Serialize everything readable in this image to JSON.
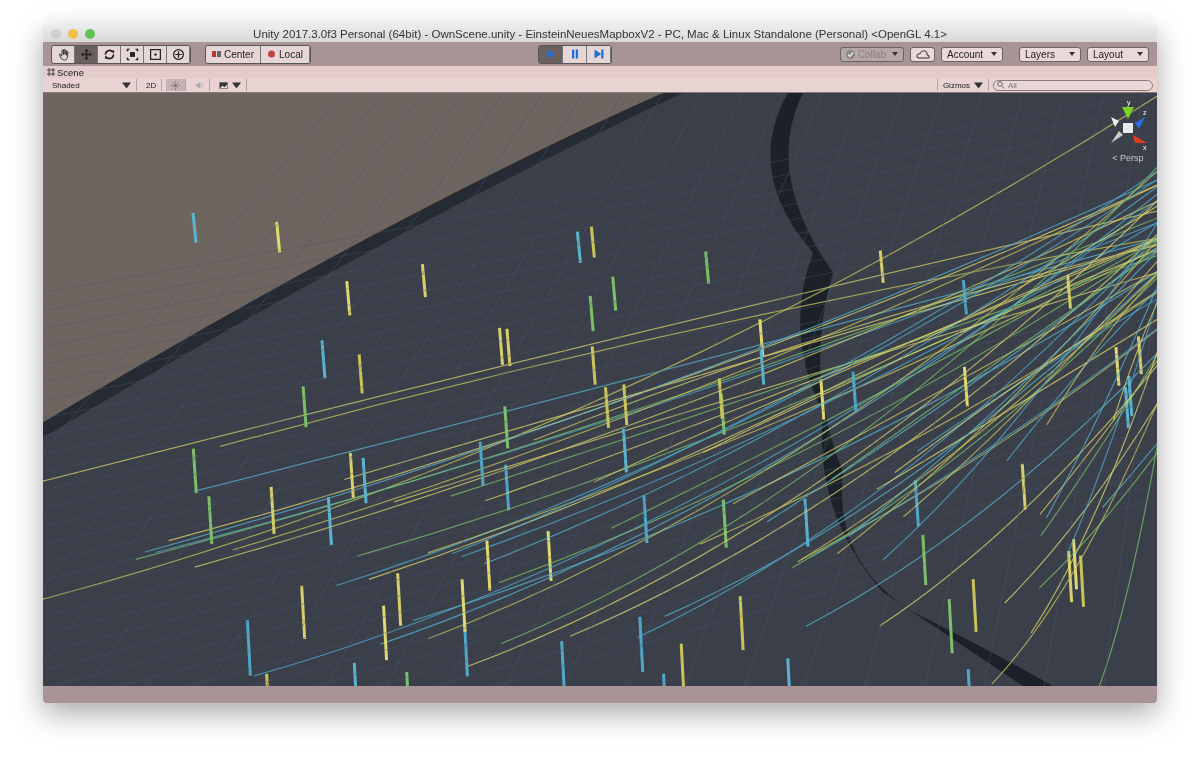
{
  "window": {
    "title": "Unity 2017.3.0f3 Personal (64bit) - OwnScene.unity - EinsteinNeuesMapboxV2 - PC, Mac & Linux Standalone (Personal) <OpenGL 4.1>"
  },
  "tools": [
    {
      "kind": "hand",
      "selected": false
    },
    {
      "kind": "move",
      "selected": true
    },
    {
      "kind": "rotate",
      "selected": false
    },
    {
      "kind": "scale",
      "selected": false
    },
    {
      "kind": "rect",
      "selected": false
    },
    {
      "kind": "transform",
      "selected": false
    }
  ],
  "pivot": [
    {
      "kind": "center",
      "label": "Center"
    },
    {
      "kind": "local",
      "label": "Local"
    }
  ],
  "playback": [
    {
      "kind": "play",
      "on": true
    },
    {
      "kind": "pause",
      "on": false
    },
    {
      "kind": "step",
      "on": false
    }
  ],
  "collab": {
    "label": "Collab",
    "disabled": true
  },
  "account": "Account",
  "layers": "Layers",
  "layout": "Layout",
  "scene_tab": {
    "label": "Scene"
  },
  "scene_toolbar": {
    "shading": "Shaded",
    "mode_2d": {
      "label": "2D",
      "selected": false
    },
    "lighting": {
      "on": true
    },
    "audio": {
      "on": false
    },
    "gizmos": "Gizmos",
    "search": {
      "placeholder": "All"
    }
  },
  "gizmo": {
    "axes": [
      "y",
      "z",
      "x"
    ],
    "label": "< Persp"
  }
}
